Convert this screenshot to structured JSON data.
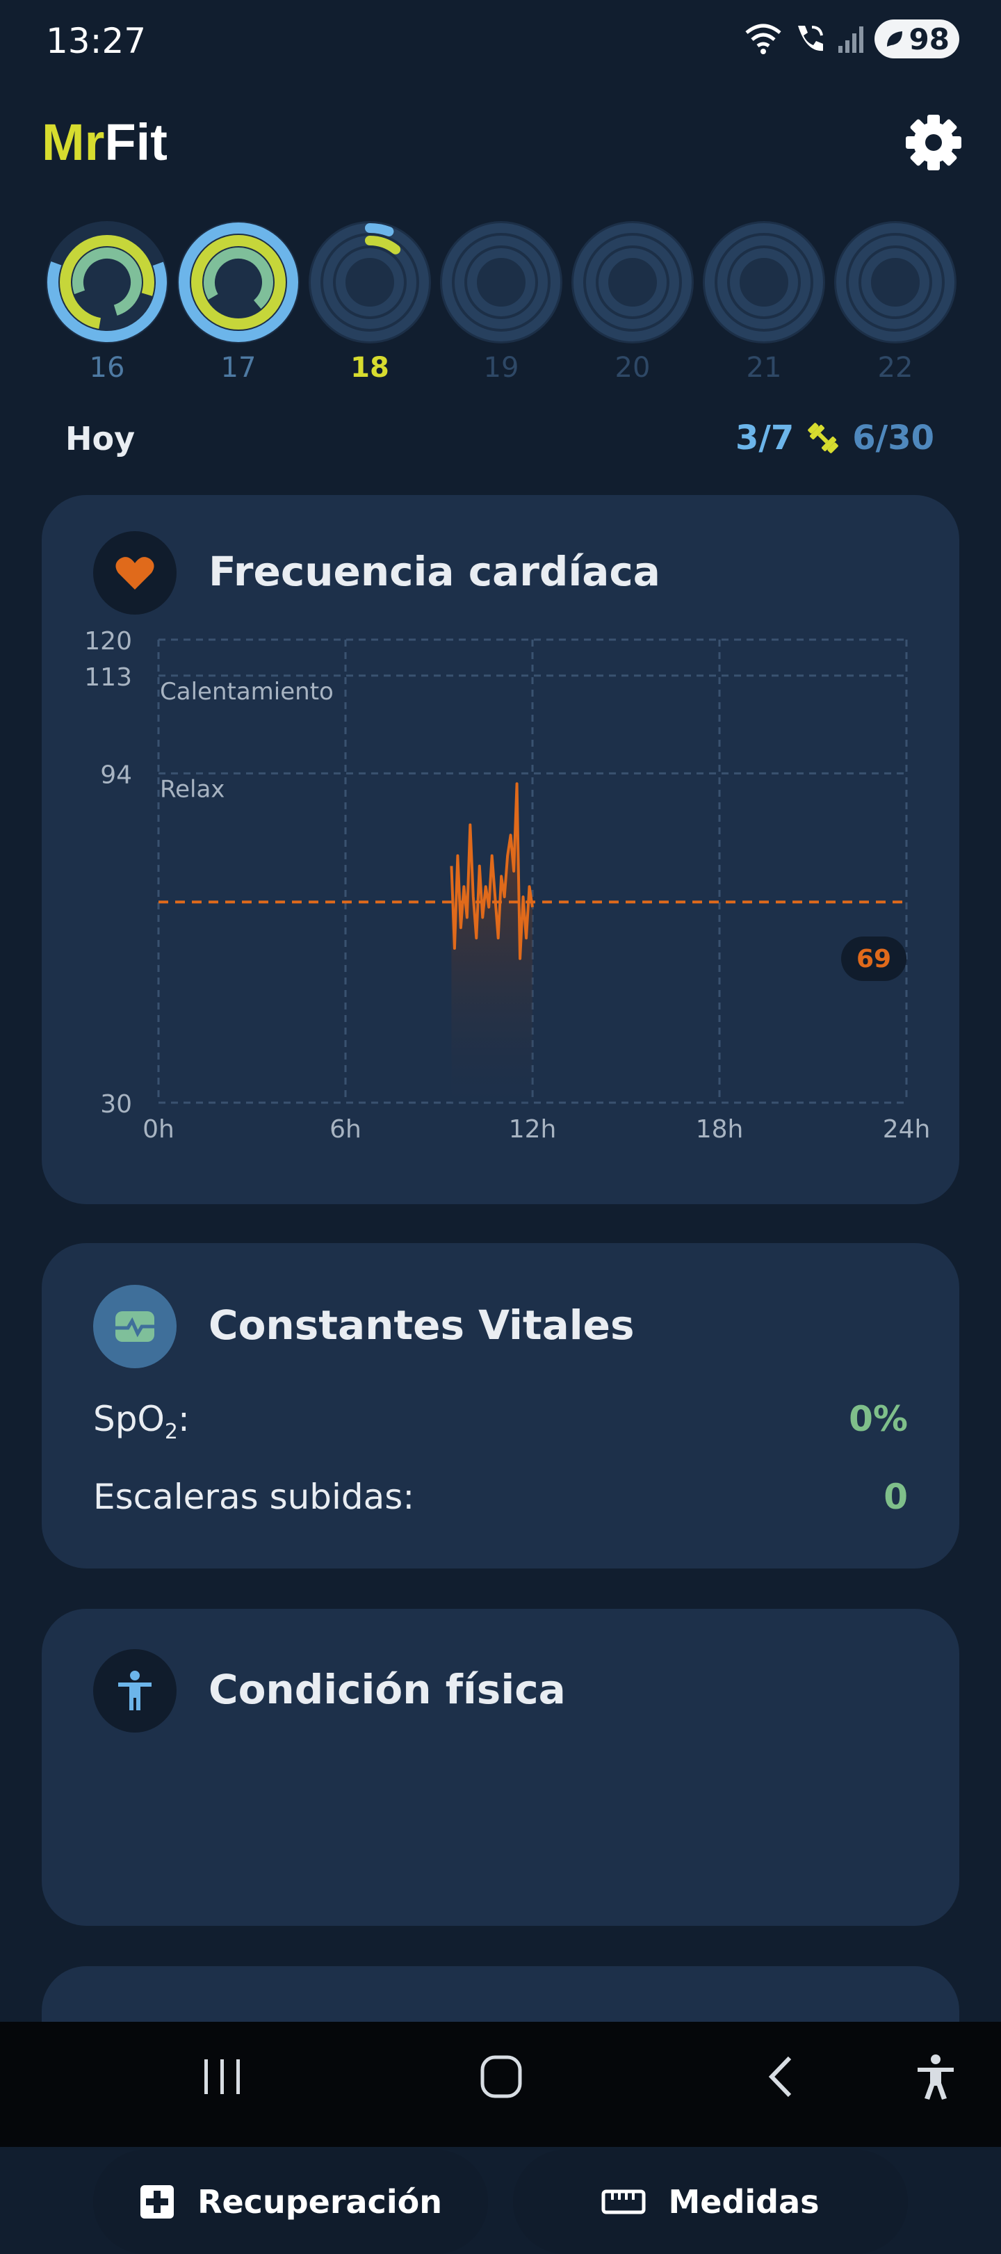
{
  "status_bar": {
    "time": "13:27",
    "battery": "98"
  },
  "app": {
    "title_part1": "Mr",
    "title_part2": "Fit"
  },
  "days": [
    {
      "label": "16",
      "state": "past"
    },
    {
      "label": "17",
      "state": "past"
    },
    {
      "label": "18",
      "state": "today"
    },
    {
      "label": "19",
      "state": "future"
    },
    {
      "label": "20",
      "state": "future"
    },
    {
      "label": "21",
      "state": "future"
    },
    {
      "label": "22",
      "state": "future"
    }
  ],
  "summary": {
    "today_label": "Hoy",
    "workouts": "3/7",
    "progress": "6/30"
  },
  "heart_rate": {
    "title": "Frecuencia cardíaca",
    "current_badge": "69",
    "zones": {
      "warmup": "Calentamiento",
      "relax": "Relax"
    },
    "chart_data": {
      "type": "line",
      "title": "Frecuencia cardíaca",
      "xlabel": "",
      "ylabel": "",
      "x_ticks": [
        "0h",
        "6h",
        "12h",
        "18h",
        "24h"
      ],
      "y_ticks": [
        120,
        113,
        94,
        30
      ],
      "ylim": [
        30,
        120
      ],
      "xlim": [
        0,
        24
      ],
      "grid": true,
      "reference_line": 69,
      "series": [
        {
          "x": [
            9.4,
            9.5,
            9.6,
            9.7,
            9.8,
            9.9,
            10.0,
            10.1,
            10.2,
            10.3,
            10.4,
            10.5,
            10.6,
            10.7,
            10.8,
            10.9,
            11.0,
            11.1,
            11.2,
            11.3,
            11.4,
            11.5,
            11.6,
            11.7,
            11.8,
            11.9,
            12.0
          ],
          "y": [
            76,
            60,
            78,
            64,
            72,
            66,
            84,
            70,
            62,
            76,
            66,
            72,
            68,
            78,
            70,
            62,
            74,
            70,
            78,
            82,
            75,
            92,
            58,
            70,
            62,
            72,
            68
          ]
        }
      ]
    }
  },
  "vitals": {
    "title": "Constantes Vitales",
    "spo2_label_main": "SpO",
    "spo2_label_sub": "2",
    "spo2_label_colon": ":",
    "spo2_value": "0%",
    "stairs_label": "Escaleras subidas:",
    "stairs_value": "0"
  },
  "fitness": {
    "title": "Condición física",
    "recovery_label": "Recuperación",
    "measures_label": "Medidas"
  },
  "colors": {
    "accent_yellow": "#d7dc2f",
    "accent_blue": "#6cb5ea",
    "heart_orange": "#e06a1b",
    "green_value": "#7fbf8a"
  }
}
